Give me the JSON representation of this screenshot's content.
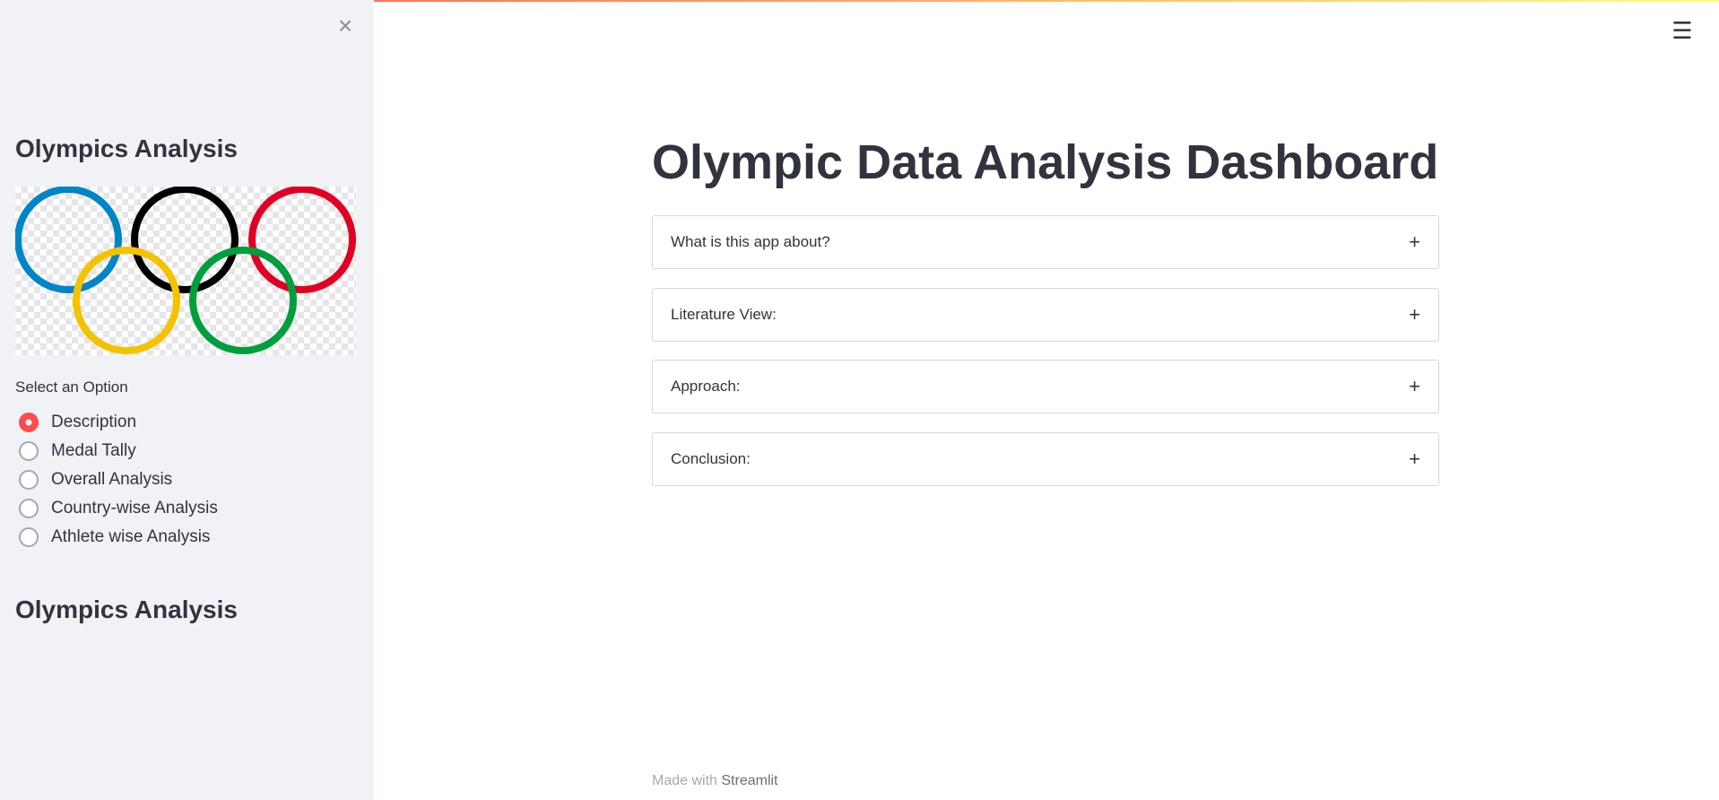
{
  "sidebar": {
    "close_icon": "×",
    "title_top": "Olympics Analysis",
    "title_bottom": "Olympics Analysis",
    "radio_label": "Select an Option",
    "options": [
      "Description",
      "Medal Tally",
      "Overall Analysis",
      "Country-wise Analysis",
      "Athlete wise Analysis"
    ],
    "selected_option": "Description",
    "ring_colors": [
      "#0085c7",
      "#000000",
      "#df0024",
      "#f4c300",
      "#009f3d"
    ]
  },
  "header": {
    "menu_icon": "☰"
  },
  "main": {
    "title": "Olympic Data Analysis Dashboard",
    "expanders": [
      {
        "label": "What is this app about?",
        "icon": "+"
      },
      {
        "label": "Literature View:",
        "icon": "+"
      },
      {
        "label": "Approach:",
        "icon": "+"
      },
      {
        "label": "Conclusion:",
        "icon": "+"
      }
    ]
  },
  "footer": {
    "prefix": "Made with",
    "link": "Streamlit"
  },
  "colors": {
    "accent": "#ff4b4b",
    "sidebar_bg": "#f0f2f6",
    "text": "#31333f"
  }
}
